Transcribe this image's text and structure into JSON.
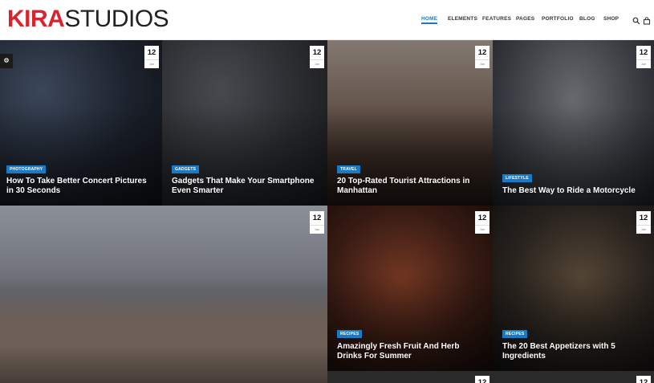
{
  "brand": {
    "part1": "KIRA",
    "part2": "STUDIOS",
    "accent": "#d9232e"
  },
  "nav": {
    "items": [
      "HOME",
      "ELEMENTS",
      "FEATURES",
      "PAGES",
      "PORTFOLIO",
      "BLOG",
      "SHOP"
    ],
    "active": "HOME",
    "icons": [
      "search-icon",
      "cart-icon"
    ]
  },
  "colors": {
    "category_badge": "#1a7bc4"
  },
  "posts": [
    {
      "day": "12",
      "month": "Jan",
      "category": "PHOTOGRAPHY",
      "title": "How To Take Better Concert Pictures in 30 Seconds"
    },
    {
      "day": "12",
      "month": "Jan",
      "category": "GADGETS",
      "title": "Gadgets That Make Your Smartphone Even Smarter"
    },
    {
      "day": "12",
      "month": "Jan",
      "category": "TRAVEL",
      "title": "20 Top-Rated Tourist Attractions in Manhattan"
    },
    {
      "day": "12",
      "month": "Jan",
      "category": "LIFESTYLE",
      "title": "The Best Way to Ride a Motorcycle"
    },
    {
      "day": "12",
      "month": "Jan"
    },
    {
      "day": "12",
      "month": "Jan",
      "category": "RECIPES",
      "title": "Amazingly Fresh Fruit And Herb Drinks For Summer"
    },
    {
      "day": "12",
      "month": "Jan",
      "category": "RECIPES",
      "title": "The 20 Best Appetizers with 5 Ingredients"
    },
    {
      "day": "12"
    },
    {
      "day": "12"
    }
  ]
}
